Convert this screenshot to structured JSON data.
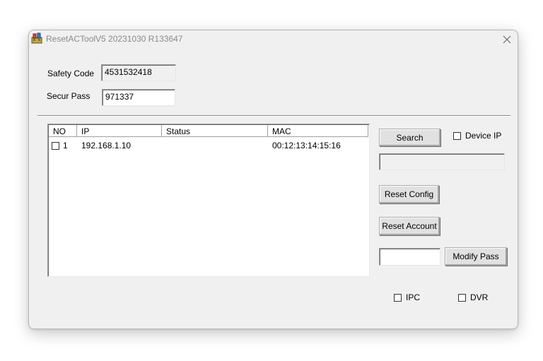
{
  "window": {
    "title": "ResetACToolV5 20231030 R133647"
  },
  "fields": {
    "safety_code": {
      "label": "Safety Code",
      "value": "4531532418"
    },
    "secur_pass": {
      "label": "Secur Pass",
      "value": "971337"
    }
  },
  "device_list": {
    "columns": [
      "NO",
      "IP",
      "Status",
      "MAC"
    ],
    "rows": [
      {
        "no": "1",
        "ip": "192.168.1.10",
        "status": "",
        "mac": "00:12:13:14:15:16",
        "checked": false
      }
    ]
  },
  "controls": {
    "search_label": "Search",
    "device_ip_label": "Device IP",
    "device_ip_checked": false,
    "device_ip_value": "",
    "reset_config_label": "Reset Config",
    "reset_account_label": "Reset Account",
    "modify_pass_value": "",
    "modify_pass_label": "Modify Pass",
    "ipc_label": "IPC",
    "dvr_label": "DVR"
  },
  "icons": {
    "app": "app-icon",
    "close": "close-icon"
  }
}
